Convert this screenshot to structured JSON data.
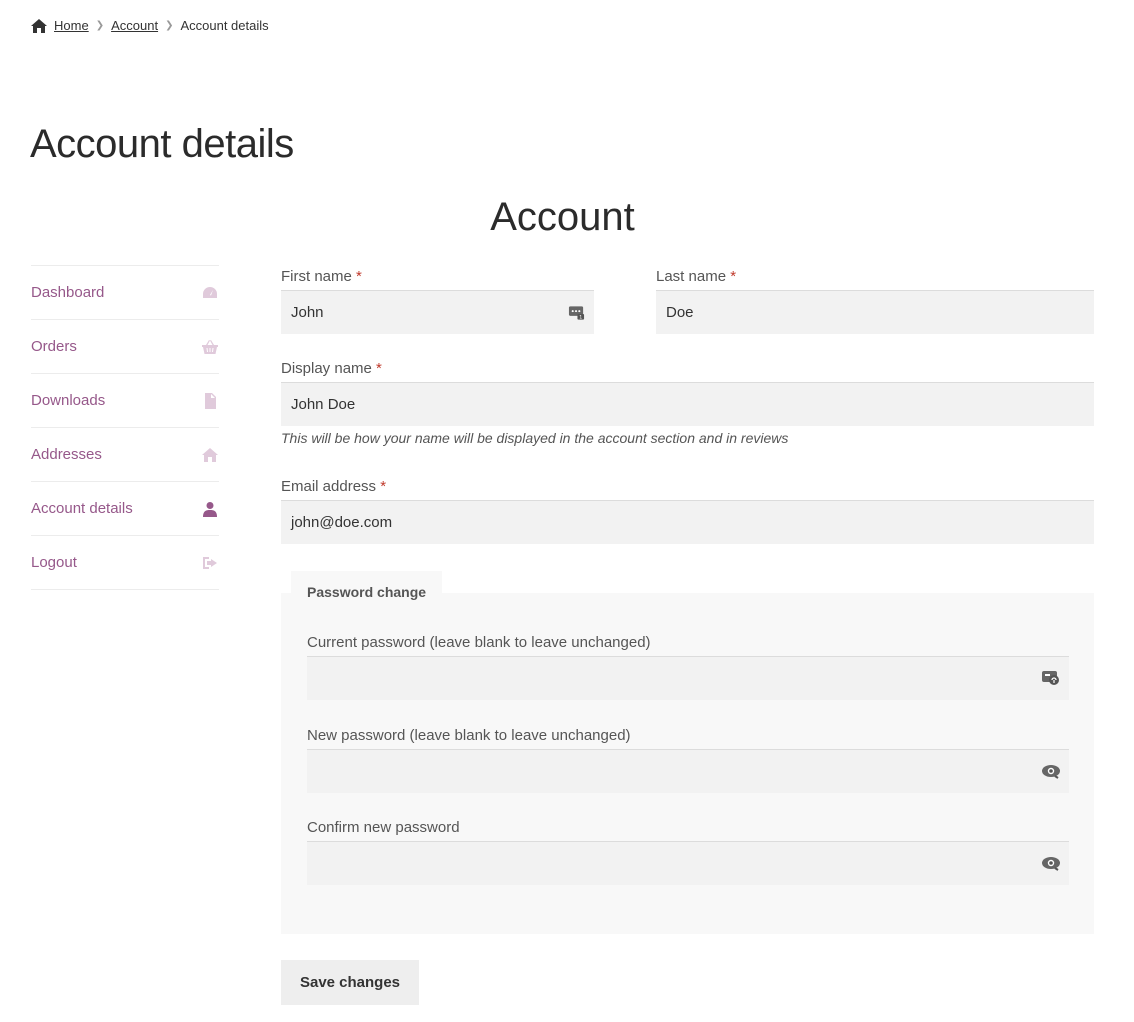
{
  "breadcrumb": {
    "home": "Home",
    "account": "Account",
    "current": "Account details"
  },
  "page_title": "Account details",
  "section_title": "Account",
  "nav": [
    {
      "label": "Dashboard",
      "icon": "dashboard-icon"
    },
    {
      "label": "Orders",
      "icon": "basket-icon"
    },
    {
      "label": "Downloads",
      "icon": "file-icon"
    },
    {
      "label": "Addresses",
      "icon": "home-icon"
    },
    {
      "label": "Account details",
      "icon": "user-icon",
      "active": true
    },
    {
      "label": "Logout",
      "icon": "logout-icon"
    }
  ],
  "form": {
    "first_name": {
      "label": "First name",
      "value": "John"
    },
    "last_name": {
      "label": "Last name",
      "value": "Doe"
    },
    "display_name": {
      "label": "Display name",
      "value": "John Doe",
      "hint": "This will be how your name will be displayed in the account section and in reviews"
    },
    "email": {
      "label": "Email address",
      "value": "john@doe.com"
    },
    "required_mark": "*"
  },
  "password": {
    "legend": "Password change",
    "current_label": "Current password (leave blank to leave unchanged)",
    "new_label": "New password (leave blank to leave unchanged)",
    "confirm_label": "Confirm new password"
  },
  "save_label": "Save changes",
  "colors": {
    "accent": "#96588a",
    "icon_muted": "#e0cadb",
    "input_bg": "#f2f2f2",
    "fieldset_bg": "#f8f8f8"
  }
}
